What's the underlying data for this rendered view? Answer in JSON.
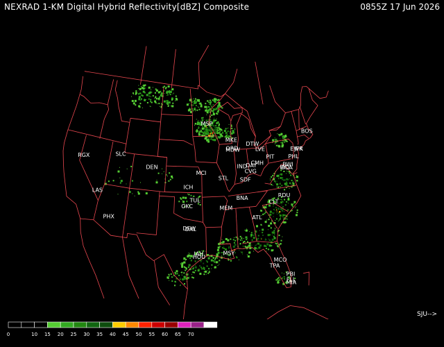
{
  "header": {
    "title": "NEXRAD 1-KM Digital Hybrid Reflectivity[dBZ] Composite",
    "timestamp": "0855Z 17 Jun 2026"
  },
  "nav_label": "SJU-->",
  "colors": {
    "background": "#000000",
    "boundaries": "#e8474f",
    "labels": "#ffffff"
  },
  "cities": [
    {
      "label": "BOS",
      "lon": -71.06,
      "lat": 42.36
    },
    {
      "label": "JFK",
      "lon": -73.78,
      "lat": 40.64
    },
    {
      "label": "EWR",
      "lon": -74.17,
      "lat": 40.69
    },
    {
      "label": "PHL",
      "lon": -75.17,
      "lat": 39.95
    },
    {
      "label": "BWI",
      "lon": -76.67,
      "lat": 39.18
    },
    {
      "label": "IAD",
      "lon": -77.46,
      "lat": 38.95
    },
    {
      "label": "DCA",
      "lon": -77.04,
      "lat": 38.85
    },
    {
      "label": "PIT",
      "lon": -80.0,
      "lat": 40.44
    },
    {
      "label": "CMH",
      "lon": -82.9,
      "lat": 39.96
    },
    {
      "label": "DAY",
      "lon": -84.19,
      "lat": 39.76
    },
    {
      "label": "CVG",
      "lon": -84.51,
      "lat": 39.1
    },
    {
      "label": "SDF",
      "lon": -85.76,
      "lat": 38.25
    },
    {
      "label": "IND",
      "lon": -86.16,
      "lat": 39.77
    },
    {
      "label": "DTW",
      "lon": -83.35,
      "lat": 42.21
    },
    {
      "label": "LVE",
      "lon": -81.85,
      "lat": 41.5
    },
    {
      "label": "ORD",
      "lon": -87.9,
      "lat": 41.98
    },
    {
      "label": "MDW",
      "lon": -87.75,
      "lat": 41.79
    },
    {
      "label": "MKE",
      "lon": -87.9,
      "lat": 42.95
    },
    {
      "label": "MSP",
      "lon": -93.27,
      "lat": 44.98
    },
    {
      "label": "STL",
      "lon": -90.2,
      "lat": 38.63
    },
    {
      "label": "MCI",
      "lon": -94.71,
      "lat": 39.3
    },
    {
      "label": "ICH",
      "lon": -97.33,
      "lat": 37.69
    },
    {
      "label": "TUL",
      "lon": -95.99,
      "lat": 36.15
    },
    {
      "label": "OKC",
      "lon": -97.52,
      "lat": 35.47
    },
    {
      "label": "DFW",
      "lon": -97.04,
      "lat": 32.9
    },
    {
      "label": "DAL",
      "lon": -96.8,
      "lat": 32.85
    },
    {
      "label": "IAH",
      "lon": -95.34,
      "lat": 29.98
    },
    {
      "label": "HOU",
      "lon": -95.28,
      "lat": 29.65
    },
    {
      "label": "MSY",
      "lon": -90.07,
      "lat": 29.95
    },
    {
      "label": "MEM",
      "lon": -90.05,
      "lat": 35.15
    },
    {
      "label": "BNA",
      "lon": -86.78,
      "lat": 36.16
    },
    {
      "label": "ATL",
      "lon": -84.39,
      "lat": 33.75
    },
    {
      "label": "CLT",
      "lon": -80.84,
      "lat": 35.23
    },
    {
      "label": "RDU",
      "lon": -78.64,
      "lat": 35.78
    },
    {
      "label": "MCO",
      "lon": -81.38,
      "lat": 28.54
    },
    {
      "label": "TPA",
      "lon": -82.46,
      "lat": 27.95
    },
    {
      "label": "PBI",
      "lon": -80.05,
      "lat": 26.71
    },
    {
      "label": "FLL",
      "lon": -80.15,
      "lat": 26.07
    },
    {
      "label": "MIA",
      "lon": -80.19,
      "lat": 25.77
    },
    {
      "label": "DEN",
      "lon": -104.99,
      "lat": 39.74
    },
    {
      "label": "SLC",
      "lon": -111.89,
      "lat": 40.76
    },
    {
      "label": "LAS",
      "lon": -115.14,
      "lat": 36.17
    },
    {
      "label": "PHX",
      "lon": -112.07,
      "lat": 33.45
    },
    {
      "label": "RGX",
      "lon": -119.46,
      "lat": 39.75
    }
  ],
  "legend": {
    "colors": [
      "#000000",
      "#000000",
      "#000000",
      "#55cc33",
      "#33aa22",
      "#228811",
      "#116611",
      "#0d4d0d",
      "#ffcc00",
      "#ff8800",
      "#ff2200",
      "#cc0000",
      "#990000",
      "#dd22bb",
      "#992288",
      "#ffffff"
    ],
    "labels": [
      "0",
      "10",
      "15",
      "20",
      "25",
      "30",
      "35",
      "40",
      "45",
      "50",
      "55",
      "60",
      "65",
      "70"
    ]
  },
  "radar_regions": [
    {
      "lon": -93.3,
      "lat": 44.8,
      "r": 2.2,
      "n": 160,
      "max": 45
    },
    {
      "lon": -92.3,
      "lat": 44.0,
      "r": 1.8,
      "n": 90,
      "max": 55
    },
    {
      "lon": -91.6,
      "lat": 47.0,
      "r": 1.6,
      "n": 70,
      "max": 35
    },
    {
      "lon": -96.5,
      "lat": 47.2,
      "r": 1.4,
      "n": 50,
      "max": 35
    },
    {
      "lon": -103.6,
      "lat": 48.0,
      "r": 2.2,
      "n": 70,
      "max": 30
    },
    {
      "lon": -108.5,
      "lat": 47.8,
      "r": 2.5,
      "n": 70,
      "max": 30
    },
    {
      "lon": -88.7,
      "lat": 44.0,
      "r": 1.5,
      "n": 40,
      "max": 30
    },
    {
      "lon": -77.5,
      "lat": 42.2,
      "r": 1.3,
      "n": 45,
      "max": 35
    },
    {
      "lon": -78.2,
      "lat": 37.6,
      "r": 2.0,
      "n": 80,
      "max": 40
    },
    {
      "lon": -80.3,
      "lat": 34.2,
      "r": 2.6,
      "n": 130,
      "max": 45
    },
    {
      "lon": -84.2,
      "lat": 31.3,
      "r": 2.8,
      "n": 110,
      "max": 45
    },
    {
      "lon": -89.3,
      "lat": 30.4,
      "r": 2.4,
      "n": 90,
      "max": 50
    },
    {
      "lon": -95.2,
      "lat": 29.0,
      "r": 2.4,
      "n": 120,
      "max": 40
    },
    {
      "lon": -98.5,
      "lat": 27.2,
      "r": 1.6,
      "n": 50,
      "max": 35
    },
    {
      "lon": -81.0,
      "lat": 26.4,
      "r": 1.2,
      "n": 30,
      "max": 35
    },
    {
      "lon": -97.0,
      "lat": 36.2,
      "r": 1.6,
      "n": 25,
      "max": 30
    },
    {
      "lon": -110.0,
      "lat": 37.5,
      "r": 3.5,
      "n": 20,
      "max": 25
    },
    {
      "lon": -102.6,
      "lat": 38.8,
      "r": 1.5,
      "n": 15,
      "max": 25
    }
  ]
}
